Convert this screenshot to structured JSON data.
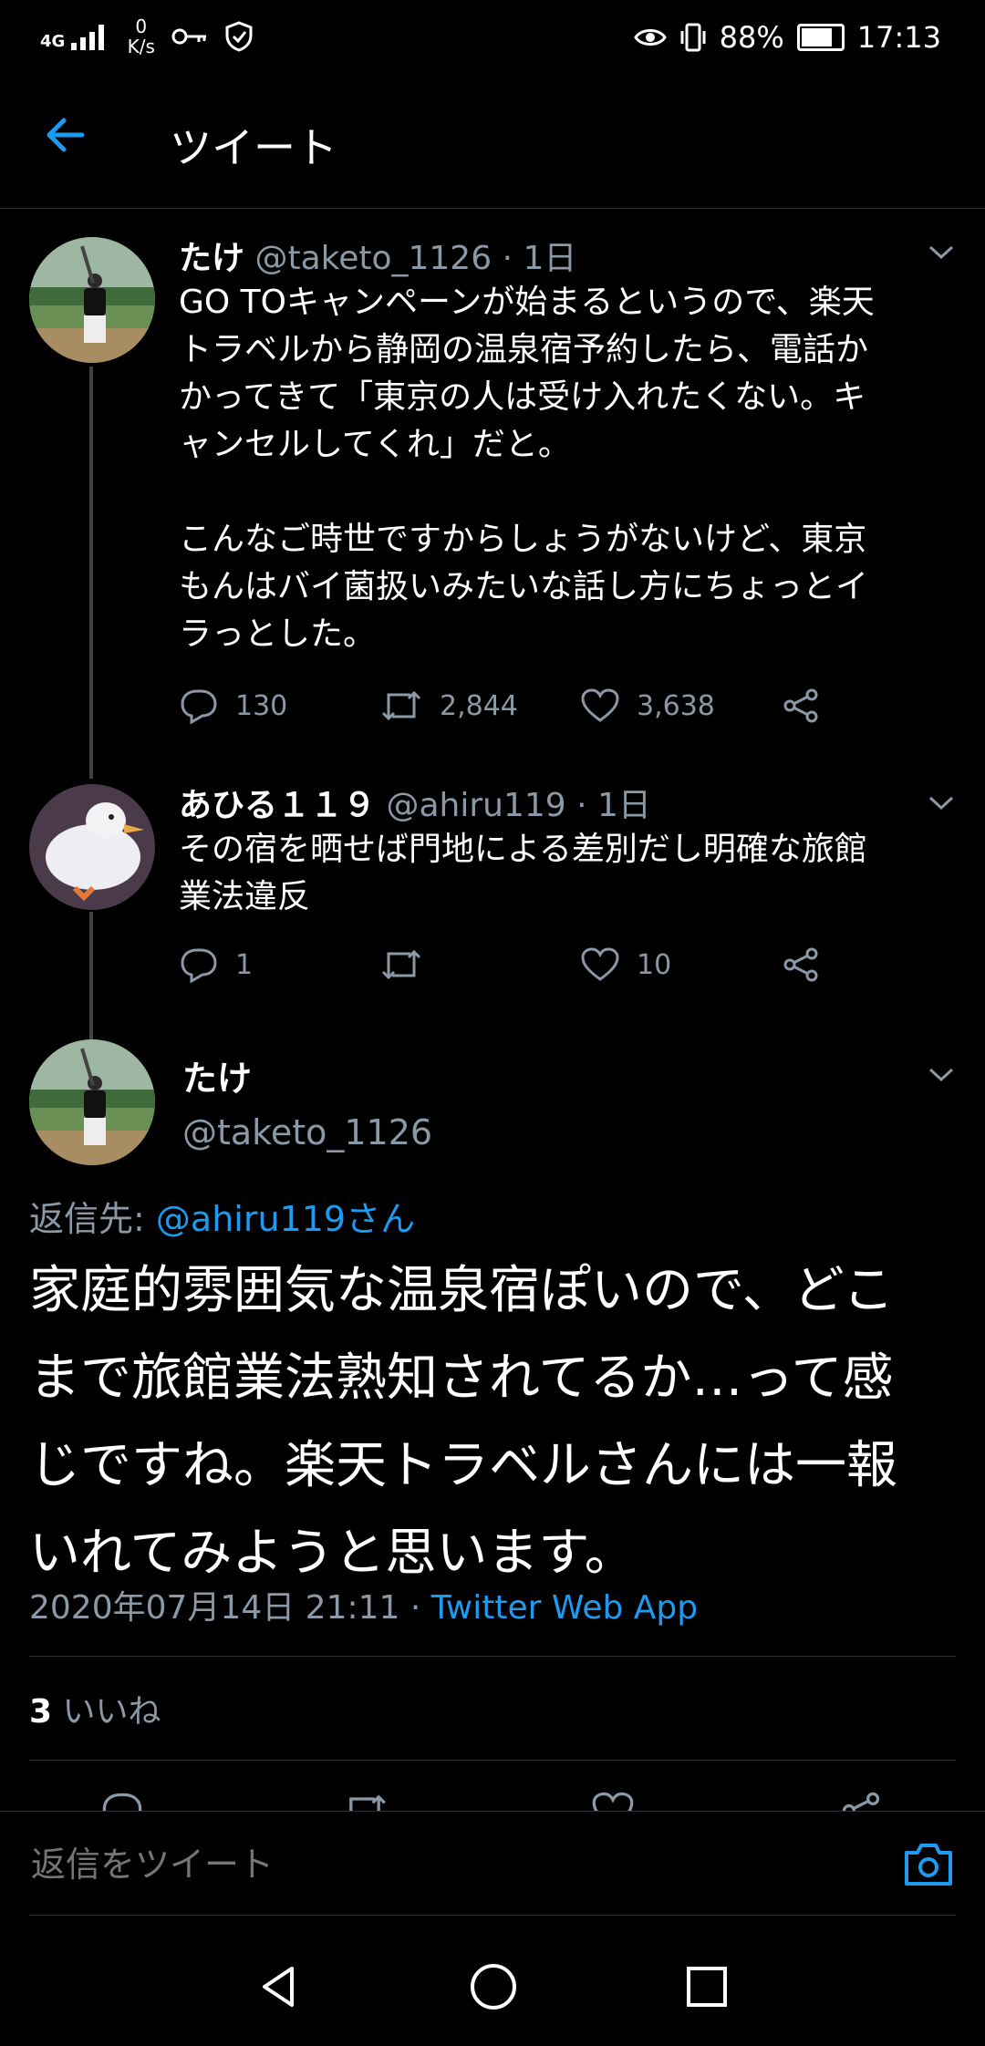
{
  "status_bar": {
    "network": "4G",
    "speed_value": "0",
    "speed_unit": "K/s",
    "battery": "88%",
    "time": "17:13",
    "battery_level": 0.88
  },
  "header": {
    "title": "ツイート"
  },
  "tweets": [
    {
      "name": "たけ",
      "handle": "@taketo_1126",
      "time": "· 1日",
      "text": "GO TOキャンペーンが始まるというので、楽天\nトラベルから静岡の温泉宿予約したら、電話か\nかってきて「東京の人は受け入れたくない。キ\nャンセルしてくれ」だと。\n\nこんなご時世ですからしょうがないけど、東京\nもんはバイ菌扱いみたいな話し方にちょっとイ\nラっとした。",
      "replies": "130",
      "retweets": "2,844",
      "likes": "3,638"
    },
    {
      "name": "あひる１１９",
      "handle": "@ahiru119",
      "time": "· 1日",
      "text": "その宿を晒せば門地による差別だし明確な旅館\n業法違反",
      "replies": "1",
      "retweets": "",
      "likes": "10"
    }
  ],
  "main_tweet": {
    "name": "たけ",
    "handle": "@taketo_1126",
    "reply_to_label": "返信先:",
    "reply_to_user": "@ahiru119さん",
    "text": "家庭的雰囲気な温泉宿ぽいので、どこ\nまで旅館業法熟知されてるか…って感\nじですね。楽天トラベルさんには一報\nいれてみようと思います。",
    "timestamp": "2020年07月14日 21:11 ·",
    "source": "Twitter Web App",
    "likes_count": "3",
    "likes_label": "いいね"
  },
  "reply_box": {
    "placeholder": "返信をツイート"
  },
  "colors": {
    "accent": "#1d9bf0",
    "background": "#000000",
    "muted": "#8b98a5"
  }
}
